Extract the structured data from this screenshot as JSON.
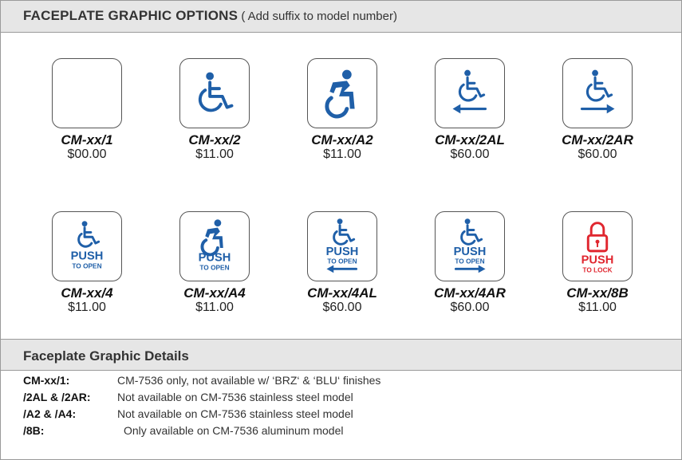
{
  "header": {
    "title": "FACEPLATE GRAPHIC OPTIONS",
    "subtitle": " ( Add suffix to model number)"
  },
  "colors": {
    "accent_blue": "#1f5fa8",
    "lock_red": "#e0262f",
    "header_bg": "#e6e6e6"
  },
  "options": [
    {
      "model": "CM-xx/1",
      "price": "$00.00",
      "icon": "blank-icon"
    },
    {
      "model": "CM-xx/2",
      "price": "$11.00",
      "icon": "wheelchair-icon"
    },
    {
      "model": "CM-xx/A2",
      "price": "$11.00",
      "icon": "accessible-wheelchair-icon"
    },
    {
      "model": "CM-xx/2AL",
      "price": "$60.00",
      "icon": "wheelchair-left-arrow-icon"
    },
    {
      "model": "CM-xx/2AR",
      "price": "$60.00",
      "icon": "wheelchair-right-arrow-icon"
    },
    {
      "model": "CM-xx/4",
      "price": "$11.00",
      "icon": "wheelchair-push-icon"
    },
    {
      "model": "CM-xx/A4",
      "price": "$11.00",
      "icon": "accessible-push-icon"
    },
    {
      "model": "CM-xx/4AL",
      "price": "$60.00",
      "icon": "wheelchair-push-left-icon"
    },
    {
      "model": "CM-xx/4AR",
      "price": "$60.00",
      "icon": "wheelchair-push-right-icon"
    },
    {
      "model": "CM-xx/8B",
      "price": "$11.00",
      "icon": "lock-push-icon"
    }
  ],
  "tile_text": {
    "push": "PUSH",
    "to_open": "TO OPEN",
    "to_lock": "TO LOCK"
  },
  "details": {
    "title": "Faceplate Graphic Details",
    "rows": [
      {
        "key": "CM-xx/1:",
        "value": "CM-7536 only, not available w/ ‘BRZ‘ & ‘BLU‘ finishes"
      },
      {
        "key": "/2AL & /2AR:",
        "value": "Not available on CM-7536 stainless steel model"
      },
      {
        "key": "/A2 & /A4:",
        "value": "Not available on CM-7536 stainless steel model"
      },
      {
        "key": "/8B:",
        "value": "Only available on CM-7536 aluminum model"
      }
    ]
  }
}
